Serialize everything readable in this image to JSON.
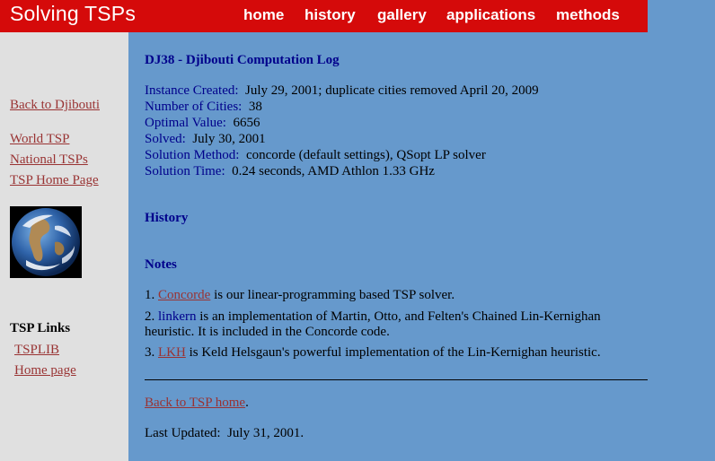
{
  "header": {
    "title": "Solving TSPs",
    "nav": [
      "home",
      "history",
      "gallery",
      "applications",
      "methods"
    ]
  },
  "sidebar": {
    "back_link": "Back to Djibouti",
    "links": [
      "World TSP",
      "National TSPs",
      "TSP Home Page"
    ],
    "image": "earth-globe",
    "tsp_links_heading": "TSP Links",
    "tsp_links": [
      "TSPLIB",
      "Home page"
    ]
  },
  "main": {
    "title": "DJ38 - Djibouti Computation Log",
    "facts": [
      {
        "label": "Instance Created:",
        "value": "July 29, 2001; duplicate cities removed April 20, 2009"
      },
      {
        "label": "Number of Cities:",
        "value": "38"
      },
      {
        "label": "Optimal Value:",
        "value": "6656"
      },
      {
        "label": "Solved:",
        "value": "July 30, 2001"
      },
      {
        "label": "Solution Method:",
        "value": "concorde (default settings), QSopt LP solver"
      },
      {
        "label": "Solution Time:",
        "value": "0.24 seconds, AMD Athlon 1.33 GHz"
      }
    ],
    "history_heading": "History",
    "notes_heading": "Notes",
    "notes": [
      {
        "num": "1.",
        "link": "Concorde",
        "text": "is our linear-programming based TSP solver."
      },
      {
        "num": "2.",
        "link": "linkern",
        "text": "is an implementation of Martin, Otto, and Felten's Chained Lin-Kernighan",
        "text2": "heuristic. It is included in the Concorde code."
      },
      {
        "num": "3.",
        "link": "LKH",
        "text": "is Keld Helsgaun's powerful implementation of the Lin-Kernighan heuristic."
      }
    ],
    "back_home_link": "Back to TSP home",
    "back_home_suffix": ".",
    "last_updated_label": "Last Updated:",
    "last_updated_value": "July 31, 2001."
  },
  "colors": {
    "header_bg": "#d50a0a",
    "main_bg": "#6699cc",
    "sidebar_bg": "#e0e0e0",
    "link": "#993333",
    "label": "#00008b"
  }
}
